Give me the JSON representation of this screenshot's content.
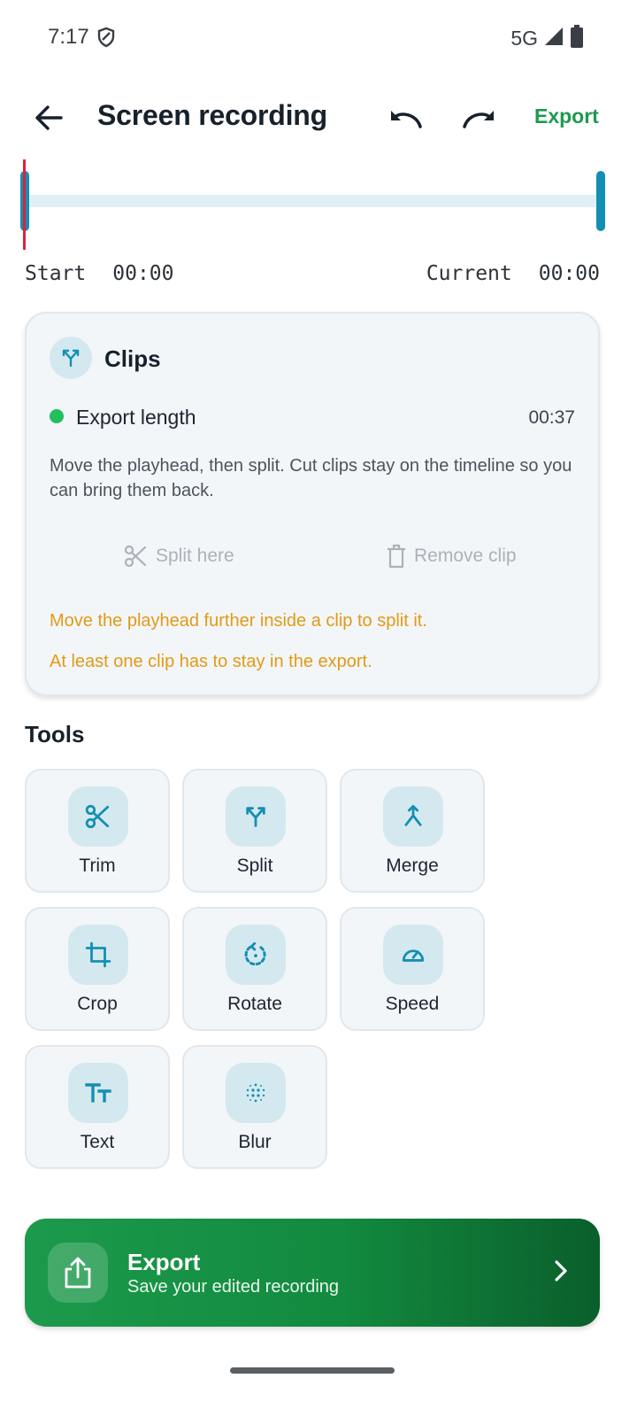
{
  "status_bar": {
    "time": "7:17",
    "network": "5G"
  },
  "app_bar": {
    "title": "Screen recording",
    "export_label": "Export"
  },
  "timeline": {
    "start_label": "Start",
    "start_time": "00:00",
    "current_label": "Current",
    "current_time": "00:00",
    "playhead_color": "#e3203a",
    "handle_color": "#138fb3"
  },
  "clips": {
    "title": "Clips",
    "export_length_label": "Export length",
    "export_length_value": "00:37",
    "description": "Move the playhead, then split. Cut clips stay on the timeline so you can bring them back.",
    "split_label": "Split here",
    "remove_label": "Remove clip",
    "warning_1": "Move the playhead further inside a clip to split it.",
    "warning_2": "At least one clip has to stay in the export.",
    "warning_color": "#e39a12",
    "status_dot_color": "#22c05d"
  },
  "tools": {
    "title": "Tools",
    "items": [
      {
        "label": "Trim",
        "icon": "scissors-icon"
      },
      {
        "label": "Split",
        "icon": "split-icon"
      },
      {
        "label": "Merge",
        "icon": "merge-icon"
      },
      {
        "label": "Crop",
        "icon": "crop-icon"
      },
      {
        "label": "Rotate",
        "icon": "rotate-icon"
      },
      {
        "label": "Speed",
        "icon": "speedometer-icon"
      },
      {
        "label": "Text",
        "icon": "text-icon"
      },
      {
        "label": "Blur",
        "icon": "blur-icon"
      }
    ]
  },
  "export_banner": {
    "title": "Export",
    "subtitle": "Save your edited recording",
    "color": "#1c9a4c"
  },
  "colors": {
    "accent": "#138fb3",
    "brand_green": "#1d9a4f"
  }
}
